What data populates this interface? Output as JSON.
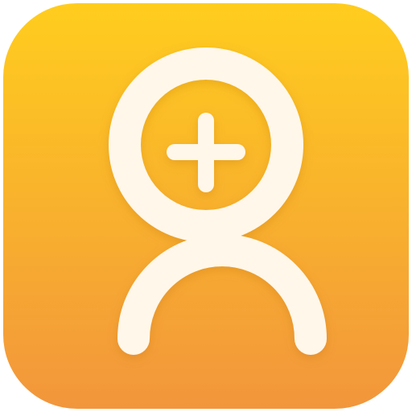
{
  "icon": {
    "name": "add-user-icon",
    "glyph": "person-outline-with-plus-in-head",
    "colors": {
      "gradient_top": "#FFCD1E",
      "gradient_bottom": "#F2963C",
      "glyph": "#FFF7EA"
    }
  }
}
